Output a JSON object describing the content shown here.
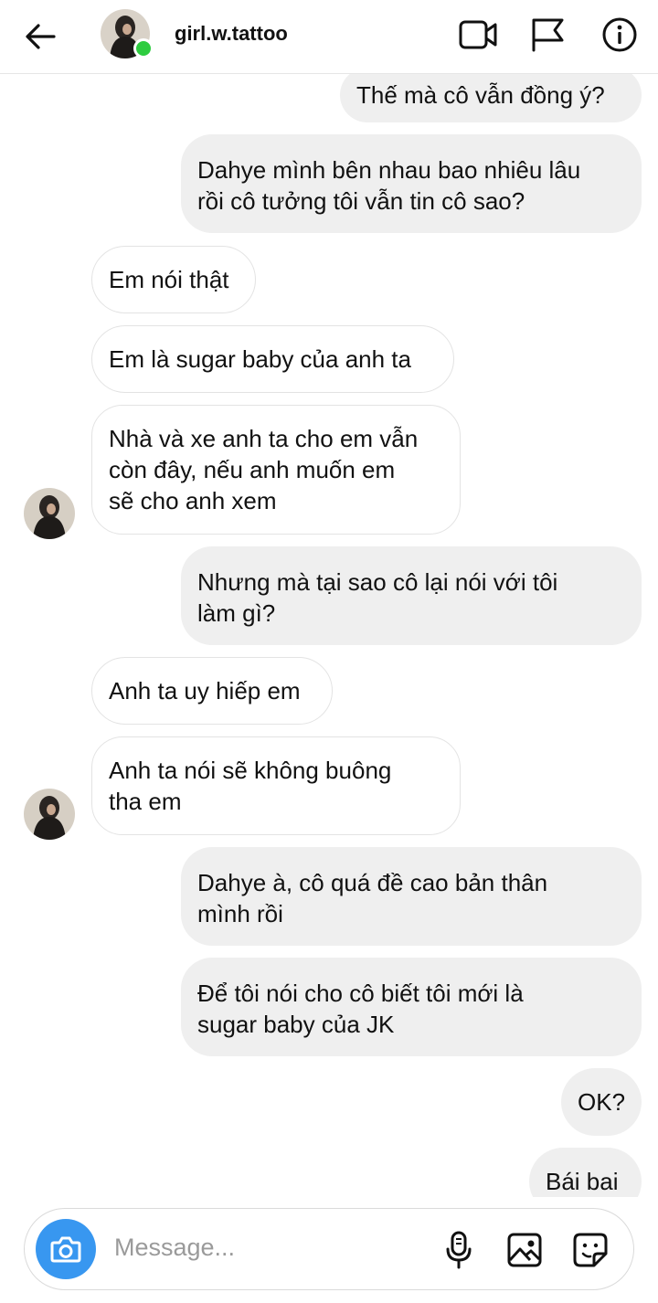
{
  "header": {
    "username": "girl.w.tattoo",
    "icons": [
      "back-arrow-icon",
      "video-call-icon",
      "flag-icon",
      "info-icon"
    ],
    "online_color": "#2ecc40"
  },
  "messages": [
    {
      "side": "sent",
      "text": "Thế mà cô vẫn đồng ý?"
    },
    {
      "side": "sent",
      "text": "Dahye mình bên nhau bao nhiêu lâu\nrồi cô tưởng tôi vẫn tin cô sao?"
    },
    {
      "side": "received",
      "text": "Em nói thật"
    },
    {
      "side": "received",
      "text": "Em là sugar baby của anh ta"
    },
    {
      "side": "received",
      "text": "Nhà và xe anh ta cho em vẫn\ncòn đây, nếu anh muốn em\nsẽ cho anh xem"
    },
    {
      "side": "sent",
      "text": "Nhưng mà tại sao cô lại nói với tôi\nlàm gì?"
    },
    {
      "side": "received",
      "text": "Anh ta uy hiếp em"
    },
    {
      "side": "received",
      "text": "Anh ta nói sẽ không buông\ntha em"
    },
    {
      "side": "sent",
      "text": "Dahye à, cô quá đề cao bản thân\nmình rồi"
    },
    {
      "side": "sent",
      "text": "Để tôi nói cho cô biết tôi mới là\nsugar baby của JK"
    },
    {
      "side": "sent",
      "text": "OK?"
    },
    {
      "side": "sent",
      "text": "Bái bai"
    }
  ],
  "composer": {
    "placeholder": "Message...",
    "camera_color": "#3897f0",
    "icons": [
      "camera-icon",
      "microphone-icon",
      "gallery-icon",
      "sticker-icon"
    ]
  }
}
